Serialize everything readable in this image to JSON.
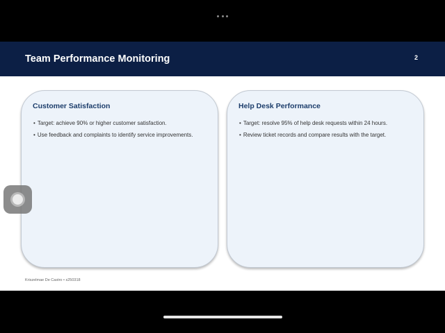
{
  "slide": {
    "title": "Team Performance Monitoring",
    "number": "2",
    "footer": "Kriszelmae De Castro • s250318"
  },
  "cards": [
    {
      "title": "Customer Satisfaction",
      "bullets": [
        "Target: achieve 90% or higher customer satisfaction.",
        "Use feedback and complaints to identify service improvements."
      ]
    },
    {
      "title": "Help Desk Performance",
      "bullets": [
        "Target: resolve 95% of help desk requests within 24 hours.",
        "Review ticket records and compare results with the target."
      ]
    }
  ],
  "icons": {
    "top_center": "more-dots-icon",
    "floating": "assistive-touch-icon"
  },
  "colors": {
    "header": "#0c1f45",
    "card_background": "#edf3fa",
    "card_title": "#1c3d6b"
  }
}
